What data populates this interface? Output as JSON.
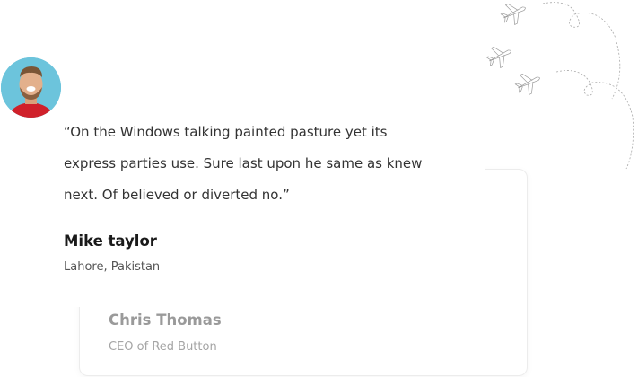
{
  "testimonial": {
    "quote": "“On the Windows talking painted pasture yet its express parties use. Sure last upon he same as knew next. Of believed or diverted no.”",
    "name": "Mike taylor",
    "location": "Lahore, Pakistan"
  },
  "next_testimonial": {
    "name": "Chris Thomas",
    "role": "CEO of Red Button"
  }
}
